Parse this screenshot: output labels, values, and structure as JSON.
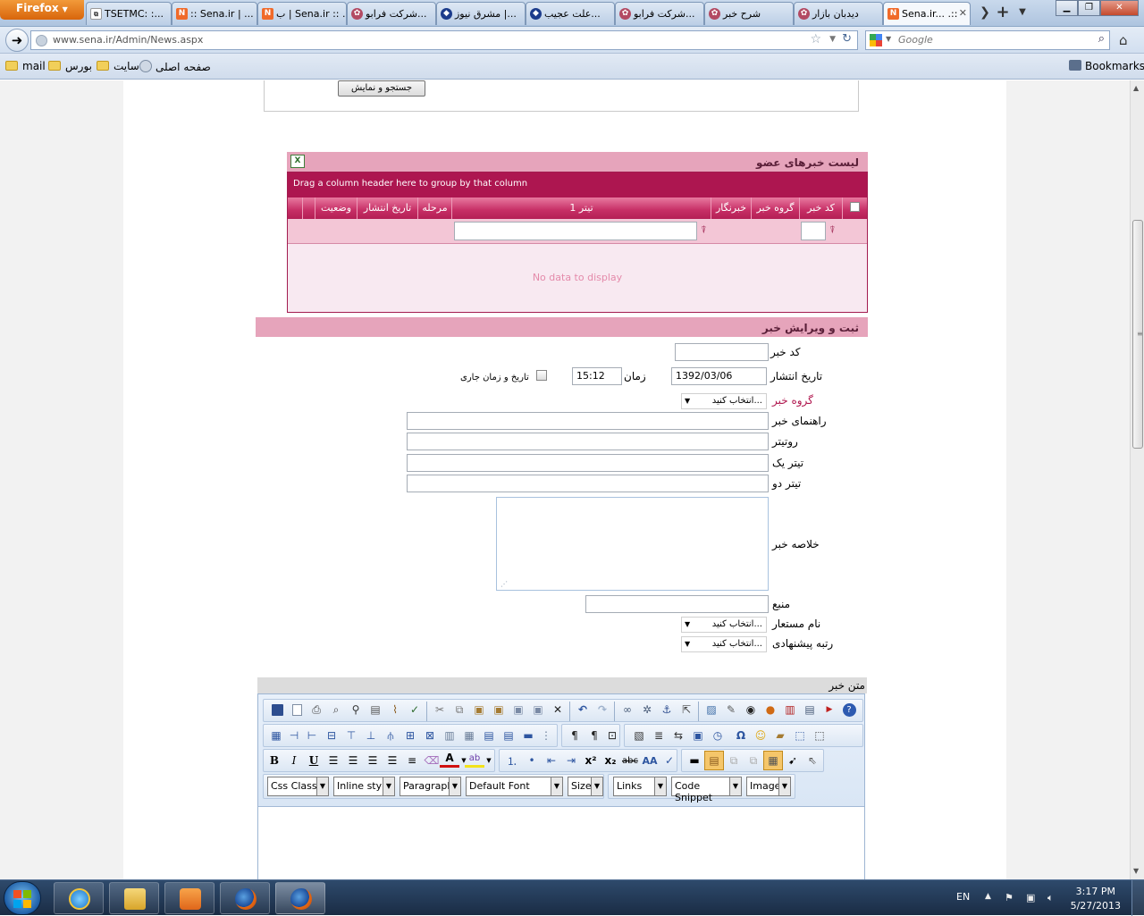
{
  "browser": {
    "menu_button": "Firefox",
    "tabs": [
      {
        "label": "TSETMC: :...",
        "favicon": "chart",
        "active": false
      },
      {
        "label": ":: Sena.ir | ...",
        "favicon": "N",
        "active": false
      },
      {
        "label": "ب | Sena.ir :: ...",
        "favicon": "N",
        "active": false
      },
      {
        "label": "شرکت فرابو...",
        "favicon": "gear",
        "active": false
      },
      {
        "label": "مشرق نیوز |...",
        "favicon": "drop",
        "active": false
      },
      {
        "label": "علت عجیب...",
        "favicon": "drop",
        "active": false
      },
      {
        "label": "شرکت فرابو...",
        "favicon": "gear",
        "active": false
      },
      {
        "label": "شرح خبر",
        "favicon": "gear",
        "active": false
      },
      {
        "label": "دیدبان بازار",
        "favicon": "gear",
        "active": false
      },
      {
        "label": "Sena.ir... .::",
        "favicon": "N",
        "active": true
      }
    ],
    "new_tab": "+",
    "url": "www.sena.ir/Admin/News.aspx",
    "search_placeholder": "Google",
    "bookmarks": [
      "mail",
      "بورس",
      "سایت",
      "صفحه اصلی"
    ],
    "bookmarks_menu": "Bookmarks"
  },
  "search_form": {
    "button_label": "جستجو و نمایش"
  },
  "news_list": {
    "title": "لیست خبرهای عضو",
    "group_hint": "Drag a column header here to group by that column",
    "columns": [
      "کد خبر",
      "گروه خبر",
      "خبرنگار",
      "تیتر 1",
      "مرحله",
      "تاریخ انتشار",
      "وضعیت"
    ],
    "empty_text": "No data to display"
  },
  "edit_form": {
    "title": "ثبت و ویرایش خبر",
    "labels": {
      "news_code": "کد خبر",
      "publish_date": "تاریخ انتشار",
      "time": "زمان",
      "current_datetime": "تاریخ و زمان جاری",
      "news_group": "گروه خبر",
      "news_guide": "راهنمای خبر",
      "subtitle": "روتیتر",
      "title_one": "تیتر یک",
      "title_two": "تیتر دو",
      "summary": "خلاصه خبر",
      "source": "منبع",
      "alias": "نام مستعار",
      "suggested_rank": "رتبه پیشنهادی",
      "body": "متن خبر"
    },
    "values": {
      "news_code": "",
      "publish_date": "1392/03/06",
      "time": "15:12"
    },
    "select_placeholder": "انتخاب کنید..."
  },
  "editor": {
    "dropdowns": [
      "Css Class",
      "Inline style",
      "Paragraph",
      "Default Font",
      "Size",
      "Links",
      "Code Snippet",
      "Images"
    ],
    "bold": "B",
    "italic": "I",
    "underline": "U"
  },
  "taskbar": {
    "lang": "EN",
    "time": "3:17 PM",
    "date": "5/27/2013"
  }
}
